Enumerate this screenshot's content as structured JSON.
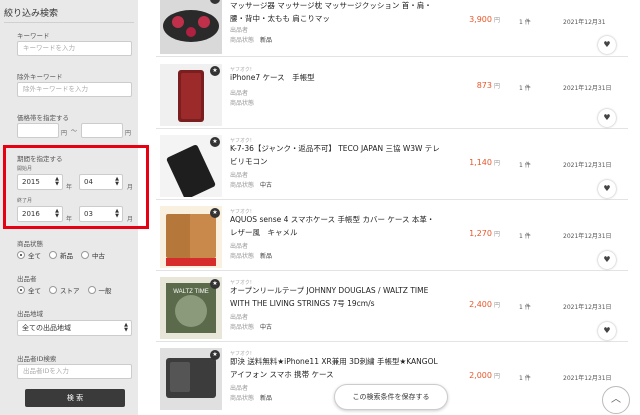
{
  "sidebar": {
    "title": "絞り込み検索",
    "keyword_label": "キーワード",
    "keyword_placeholder": "キーワードを入力",
    "exclude_label": "除外キーワード",
    "exclude_placeholder": "除外キーワードを入力",
    "price_label": "価格帯を指定する",
    "price_unit": "円",
    "price_sep": "〜",
    "period_label": "期間を指定する",
    "start_label": "開始月",
    "end_label": "終了月",
    "start_year": "2015",
    "start_month": "04",
    "end_year": "2016",
    "end_month": "03",
    "year_unit": "年",
    "month_unit": "月",
    "condition_label": "商品状態",
    "condition_options": [
      "全て",
      "新品",
      "中古"
    ],
    "seller_label": "出品者",
    "seller_options": [
      "全て",
      "ストア",
      "一般"
    ],
    "region_label": "出品地域",
    "region_value": "全ての出品地域",
    "seller_id_label": "出品者ID検索",
    "seller_id_placeholder": "出品者IDを入力",
    "search_button": "検 索"
  },
  "list": {
    "shop_label": "ヤフオク!",
    "seller_label": "出品者",
    "condition_label": "商品状態",
    "yen": "円",
    "items": [
      {
        "title": "マッサージ器 マッサージ枕 マッサージクッション 首・肩・腰・背中・太もも 肩こりマッ",
        "condition": "新品",
        "price": "3,900",
        "qty": "1 件",
        "date": "2021年12月31"
      },
      {
        "title": "iPhone7 ケース　手帳型",
        "condition": "",
        "price": "873",
        "qty": "1 件",
        "date": "2021年12月31日"
      },
      {
        "title": "K-7-36【ジャンク・返品不可】 TECO JAPAN 三協 W3W テレビリモコン",
        "condition": "中古",
        "price": "1,140",
        "qty": "1 件",
        "date": "2021年12月31日"
      },
      {
        "title": "AQUOS sense 4 スマホケース 手帳型 カバー ケース 本革・レザー風　キャメル",
        "condition": "新品",
        "price": "1,270",
        "qty": "1 件",
        "date": "2021年12月31日"
      },
      {
        "title": "オープンリールテープ JOHNNY DOUGLAS / WALTZ TIME WITH THE LIVING STRINGS 7号 19cm/s",
        "condition": "中古",
        "price": "2,400",
        "qty": "1 件",
        "date": "2021年12月31日"
      },
      {
        "title": "即決 送料無料★iPhone11 XR兼用 3D刺繍 手帳型★KANGOL アイフォン スマホ 携帯 ケース",
        "condition": "新品",
        "price": "2,000",
        "qty": "1 件",
        "date": "2021年12月31日"
      }
    ]
  },
  "save_button": "この検索条件を保存する",
  "colors": {
    "price": "#e8562a",
    "highlight": "#e60012",
    "sidebar_bg": "#e9e9e9"
  }
}
